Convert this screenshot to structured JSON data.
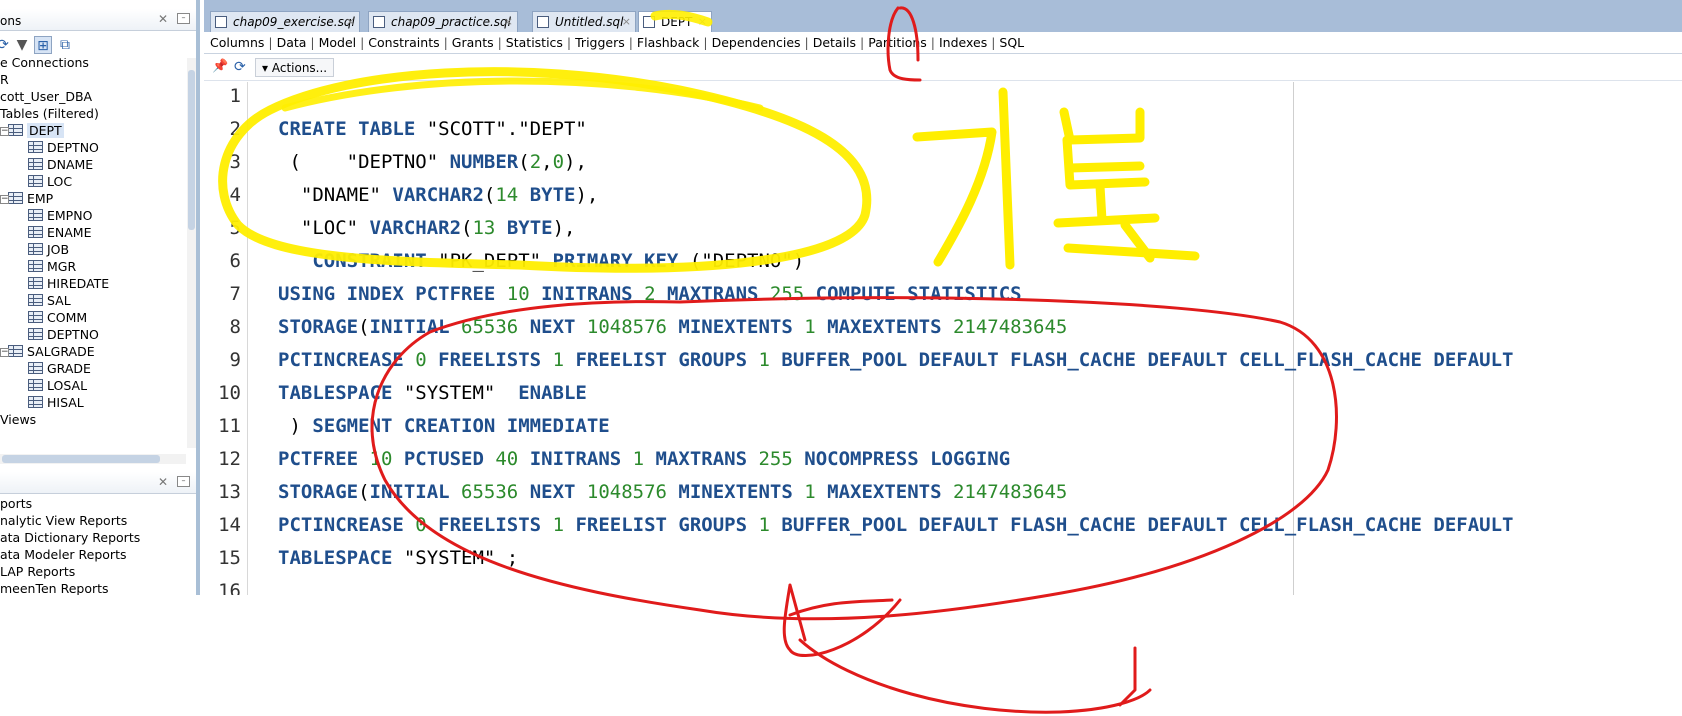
{
  "connections_panel": {
    "title": "ons",
    "tree": [
      {
        "label": "e Connections",
        "indent": 0
      },
      {
        "label": "R",
        "indent": 0
      },
      {
        "label": "cott_User_DBA",
        "indent": 0
      },
      {
        "label": "Tables (Filtered)",
        "indent": 1
      },
      {
        "label": "DEPT",
        "indent": 2,
        "type": "table",
        "selected": true
      },
      {
        "label": "DEPTNO",
        "indent": 3,
        "type": "column"
      },
      {
        "label": "DNAME",
        "indent": 3,
        "type": "column"
      },
      {
        "label": "LOC",
        "indent": 3,
        "type": "column"
      },
      {
        "label": "EMP",
        "indent": 2,
        "type": "table"
      },
      {
        "label": "EMPNO",
        "indent": 3,
        "type": "column"
      },
      {
        "label": "ENAME",
        "indent": 3,
        "type": "column"
      },
      {
        "label": "JOB",
        "indent": 3,
        "type": "column"
      },
      {
        "label": "MGR",
        "indent": 3,
        "type": "column"
      },
      {
        "label": "HIREDATE",
        "indent": 3,
        "type": "column"
      },
      {
        "label": "SAL",
        "indent": 3,
        "type": "column"
      },
      {
        "label": "COMM",
        "indent": 3,
        "type": "column"
      },
      {
        "label": "DEPTNO",
        "indent": 3,
        "type": "column"
      },
      {
        "label": "SALGRADE",
        "indent": 2,
        "type": "table"
      },
      {
        "label": "GRADE",
        "indent": 3,
        "type": "column"
      },
      {
        "label": "LOSAL",
        "indent": 3,
        "type": "column"
      },
      {
        "label": "HISAL",
        "indent": 3,
        "type": "column"
      },
      {
        "label": "Views",
        "indent": 1
      }
    ]
  },
  "reports_panel": {
    "items": [
      "ports",
      "nalytic View Reports",
      "ata Dictionary Reports",
      "ata Modeler Reports",
      "LAP Reports",
      "meenTen Reports"
    ]
  },
  "editor": {
    "tabs": [
      {
        "label": "chap09_exercise.sql",
        "active": false
      },
      {
        "label": "chap09_practice.sql",
        "active": false
      },
      {
        "label": "Untitled.sql",
        "active": false
      },
      {
        "label": "DEPT",
        "active": true
      }
    ],
    "subtabs": [
      "Columns",
      "Data",
      "Model",
      "Constraints",
      "Grants",
      "Statistics",
      "Triggers",
      "Flashback",
      "Dependencies",
      "Details",
      "Partitions",
      "Indexes",
      "SQL"
    ],
    "actions_label": "Actions...",
    "code_lines": [
      {
        "no": "1",
        "tokens": []
      },
      {
        "no": "2",
        "tokens": [
          [
            "k",
            "CREATE TABLE "
          ],
          [
            "t",
            "\"SCOTT\".\"DEPT\""
          ]
        ]
      },
      {
        "no": "3",
        "tokens": [
          [
            "t",
            " (    \"DEPTNO\" "
          ],
          [
            "k",
            "NUMBER"
          ],
          [
            "t",
            "("
          ],
          [
            "n",
            "2"
          ],
          [
            "t",
            ","
          ],
          [
            "n",
            "0"
          ],
          [
            "t",
            "),"
          ]
        ]
      },
      {
        "no": "4",
        "tokens": [
          [
            "t",
            "  \"DNAME\" "
          ],
          [
            "k",
            "VARCHAR2"
          ],
          [
            "t",
            "("
          ],
          [
            "n",
            "14"
          ],
          [
            "k",
            " BYTE"
          ],
          [
            "t",
            "),"
          ]
        ]
      },
      {
        "no": "5",
        "tokens": [
          [
            "t",
            "  \"LOC\" "
          ],
          [
            "k",
            "VARCHAR2"
          ],
          [
            "t",
            "("
          ],
          [
            "n",
            "13"
          ],
          [
            "k",
            " BYTE"
          ],
          [
            "t",
            "),"
          ]
        ]
      },
      {
        "no": "6",
        "tokens": [
          [
            "k",
            "   CONSTRAINT "
          ],
          [
            "t",
            "\"PK_DEPT\" "
          ],
          [
            "k",
            "PRIMARY KEY "
          ],
          [
            "t",
            "(\"DEPTNO\")"
          ]
        ]
      },
      {
        "no": "7",
        "tokens": [
          [
            "k",
            "USING INDEX PCTFREE "
          ],
          [
            "n",
            "10"
          ],
          [
            "k",
            " INITRANS "
          ],
          [
            "n",
            "2"
          ],
          [
            "k",
            " MAXTRANS "
          ],
          [
            "n",
            "255"
          ],
          [
            "k",
            " COMPUTE STATISTICS"
          ]
        ]
      },
      {
        "no": "8",
        "tokens": [
          [
            "k",
            "STORAGE"
          ],
          [
            "t",
            "("
          ],
          [
            "k",
            "INITIAL "
          ],
          [
            "n",
            "65536"
          ],
          [
            "k",
            " NEXT "
          ],
          [
            "n",
            "1048576"
          ],
          [
            "k",
            " MINEXTENTS "
          ],
          [
            "n",
            "1"
          ],
          [
            "k",
            " MAXEXTENTS "
          ],
          [
            "n",
            "2147483645"
          ]
        ]
      },
      {
        "no": "9",
        "tokens": [
          [
            "k",
            "PCTINCREASE "
          ],
          [
            "n",
            "0"
          ],
          [
            "k",
            " FREELISTS "
          ],
          [
            "n",
            "1"
          ],
          [
            "k",
            " FREELIST GROUPS "
          ],
          [
            "n",
            "1"
          ],
          [
            "k",
            " BUFFER_POOL DEFAULT FLASH_CACHE DEFAULT CELL_FLASH_CACHE DEFAULT"
          ]
        ]
      },
      {
        "no": "10",
        "tokens": [
          [
            "k",
            "TABLESPACE "
          ],
          [
            "t",
            "\"SYSTEM\"  "
          ],
          [
            "k",
            "ENABLE"
          ]
        ]
      },
      {
        "no": "11",
        "tokens": [
          [
            "t",
            " ) "
          ],
          [
            "k",
            "SEGMENT CREATION IMMEDIATE"
          ]
        ]
      },
      {
        "no": "12",
        "tokens": [
          [
            "k",
            "PCTFREE "
          ],
          [
            "n",
            "10"
          ],
          [
            "k",
            " PCTUSED "
          ],
          [
            "n",
            "40"
          ],
          [
            "k",
            " INITRANS "
          ],
          [
            "n",
            "1"
          ],
          [
            "k",
            " MAXTRANS "
          ],
          [
            "n",
            "255"
          ],
          [
            "k",
            " NOCOMPRESS LOGGING"
          ]
        ]
      },
      {
        "no": "13",
        "tokens": [
          [
            "k",
            "STORAGE"
          ],
          [
            "t",
            "("
          ],
          [
            "k",
            "INITIAL "
          ],
          [
            "n",
            "65536"
          ],
          [
            "k",
            " NEXT "
          ],
          [
            "n",
            "1048576"
          ],
          [
            "k",
            " MINEXTENTS "
          ],
          [
            "n",
            "1"
          ],
          [
            "k",
            " MAXEXTENTS "
          ],
          [
            "n",
            "2147483645"
          ]
        ]
      },
      {
        "no": "14",
        "tokens": [
          [
            "k",
            "PCTINCREASE "
          ],
          [
            "n",
            "0"
          ],
          [
            "k",
            " FREELISTS "
          ],
          [
            "n",
            "1"
          ],
          [
            "k",
            " FREELIST GROUPS "
          ],
          [
            "n",
            "1"
          ],
          [
            "k",
            " BUFFER_POOL DEFAULT FLASH_CACHE DEFAULT CELL_FLASH_CACHE DEFAULT"
          ]
        ]
      },
      {
        "no": "15",
        "tokens": [
          [
            "k",
            "TABLESPACE "
          ],
          [
            "t",
            "\"SYSTEM\" ;"
          ]
        ]
      },
      {
        "no": "16",
        "tokens": []
      }
    ]
  },
  "annotations": {
    "handwritten_text": "기본",
    "colors": {
      "yellow": "#ffee00",
      "red": "#e01b1b"
    }
  },
  "colors": {
    "keyword": "#1f4e8c",
    "number": "#2c8a2c",
    "tab_bar": "#a8bdd8"
  }
}
